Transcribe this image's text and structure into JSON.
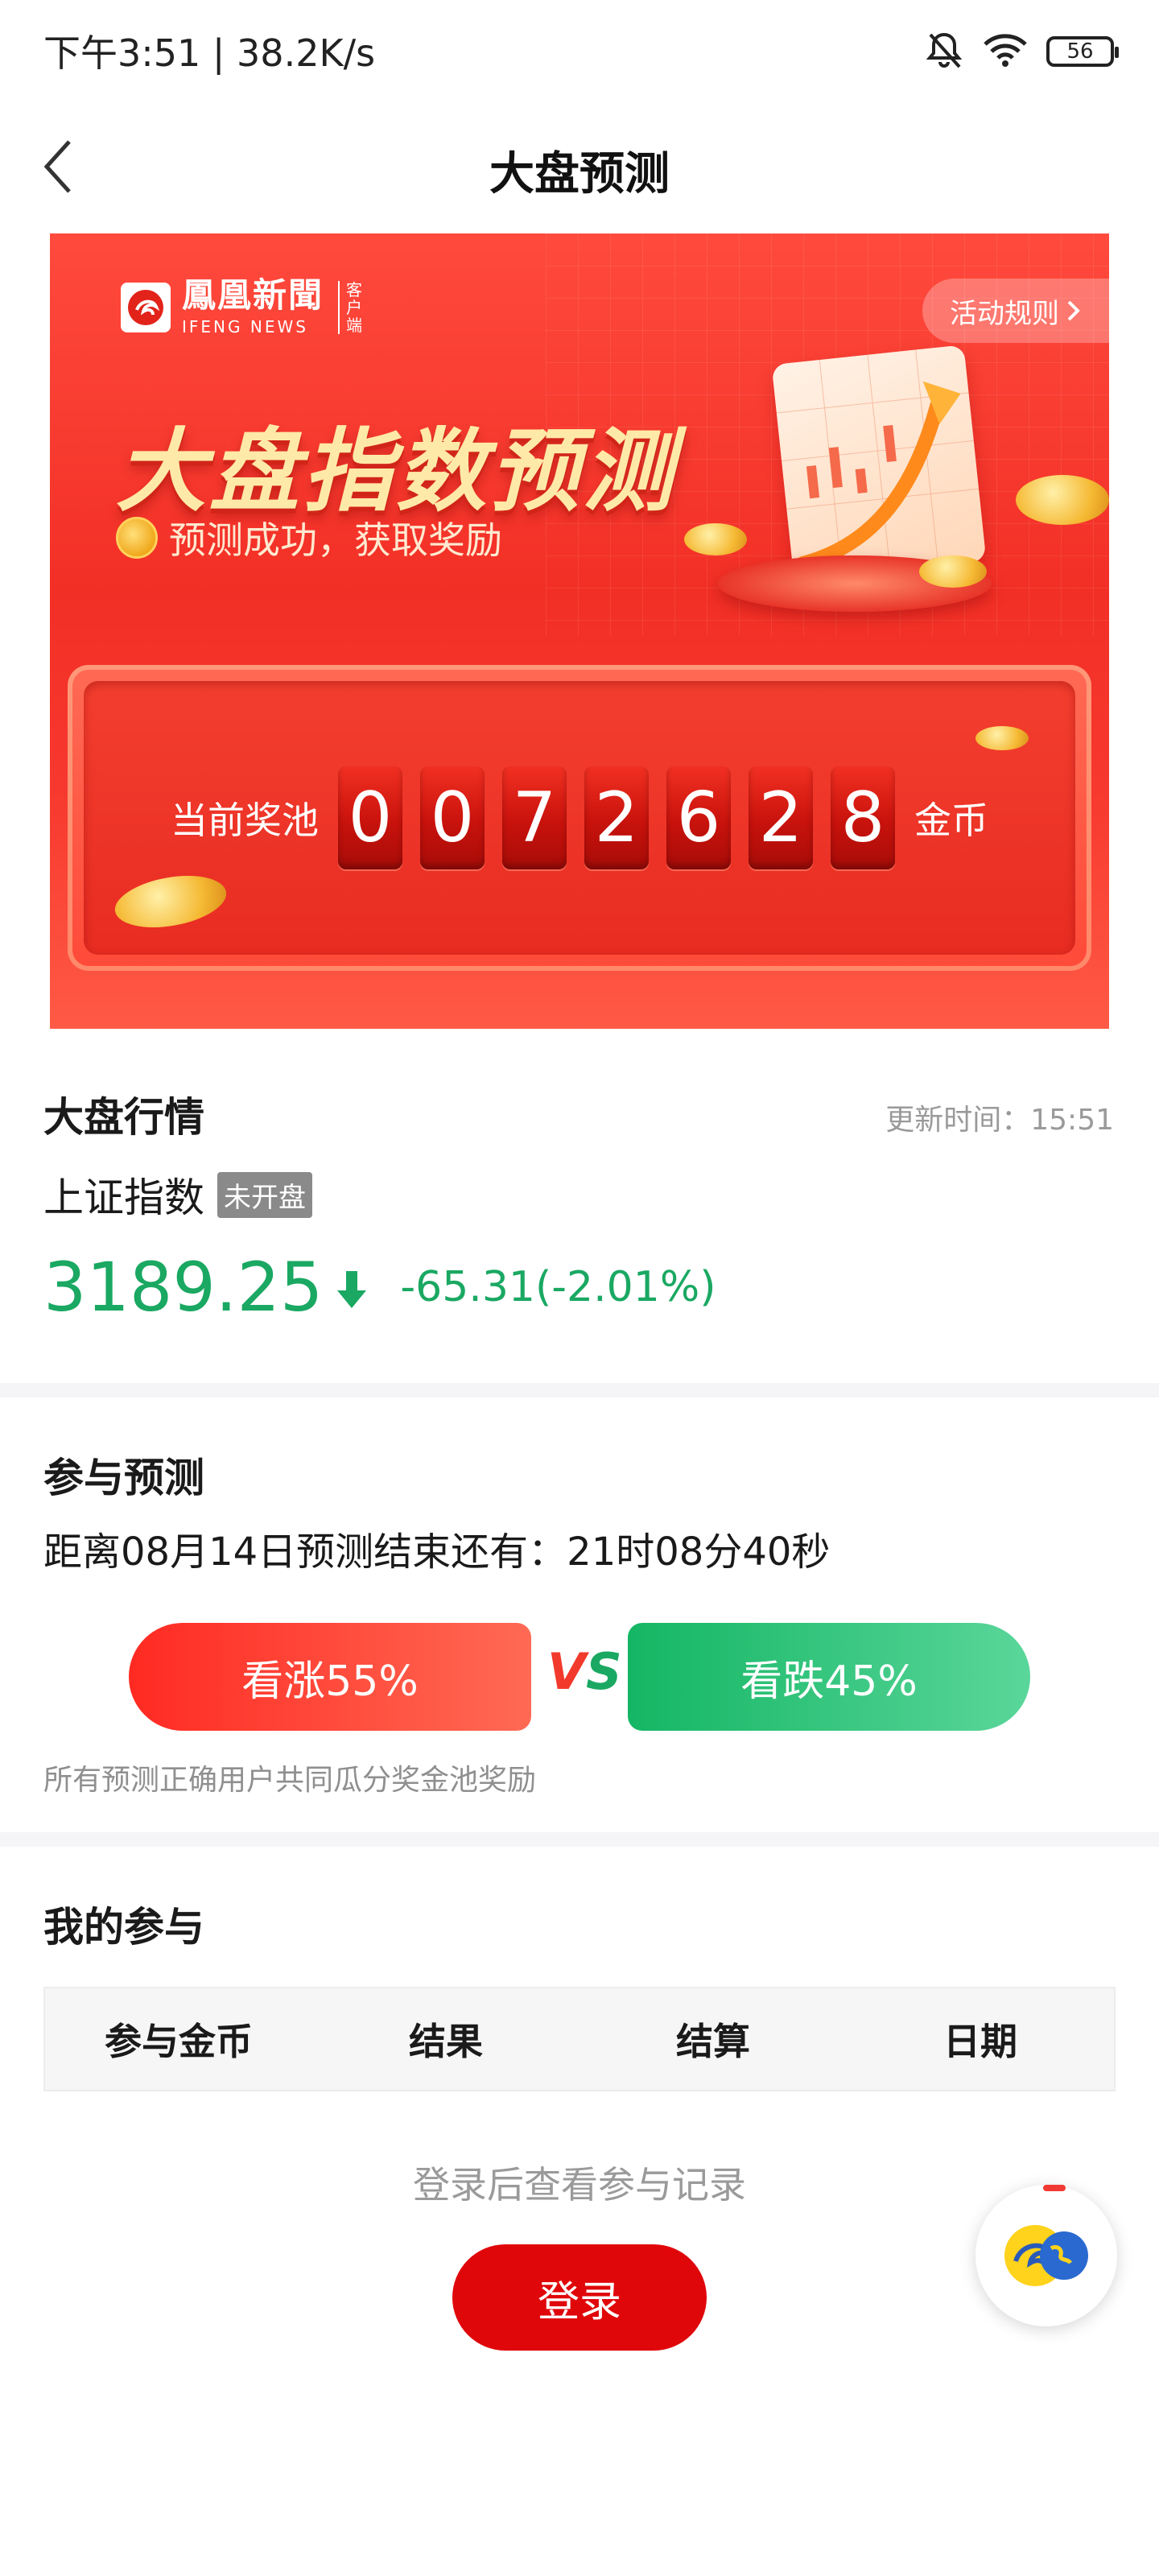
{
  "status_bar": {
    "time": "下午3:51 | 38.2K/s",
    "battery": "56",
    "icons": [
      "mute-bell-icon",
      "wifi-icon",
      "battery-icon"
    ]
  },
  "header": {
    "title": "大盘预测",
    "back_icon": "chevron-left-icon"
  },
  "banner": {
    "logo_text": "鳳凰新聞",
    "logo_sub": "IFENG NEWS",
    "logo_side": "客户端",
    "rules_label": "活动规则",
    "title": "大盘指数预测",
    "subtitle": "预测成功，获取奖励",
    "pool_label": "当前奖池",
    "pool_digits": [
      "0",
      "0",
      "7",
      "2",
      "6",
      "2",
      "8"
    ],
    "pool_unit": "金币"
  },
  "market": {
    "title": "大盘行情",
    "update_time": "更新时间：15:51",
    "index_name": "上证指数",
    "status_tag": "未开盘",
    "price": "3189.25",
    "change": "-65.31(-2.01%)"
  },
  "participate": {
    "title": "参与预测",
    "countdown": "距离08月14日预测结束还有：21时08分40秒",
    "up_label": "看涨55%",
    "down_label": "看跌45%",
    "vs_v": "V",
    "vs_s": "S",
    "note": "所有预测正确用户共同瓜分奖金池奖励"
  },
  "mine": {
    "title": "我的参与",
    "columns": [
      "参与金币",
      "结果",
      "结算",
      "日期"
    ],
    "empty_note": "登录后查看参与记录",
    "login_label": "登录"
  },
  "colors": {
    "rise": "#f23a2c",
    "fall": "#1aa862",
    "login": "#e0070b"
  }
}
